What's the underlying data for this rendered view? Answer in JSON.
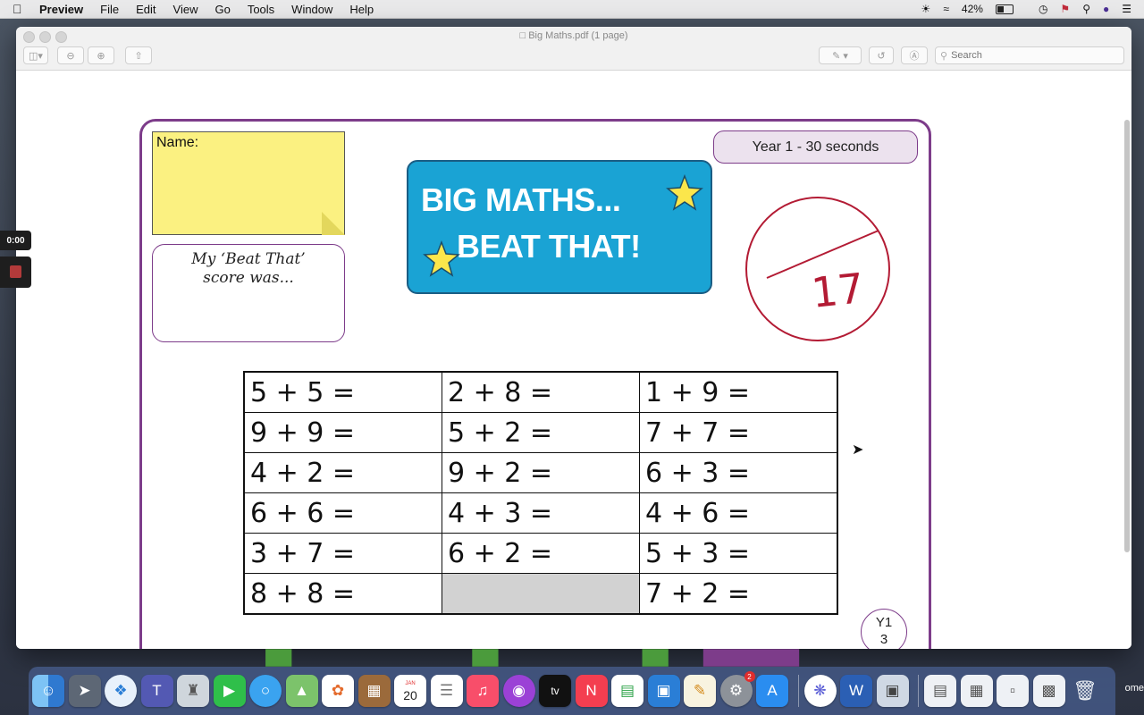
{
  "menubar": {
    "app_name": "Preview",
    "items": [
      "File",
      "Edit",
      "View",
      "Go",
      "Tools",
      "Window",
      "Help"
    ],
    "battery": "42%"
  },
  "window": {
    "title": "Big Maths.pdf (1 page)",
    "search_placeholder": "Search"
  },
  "recording": {
    "time": "0:00"
  },
  "sheet": {
    "name_label": "Name:",
    "beat_that_line1": "My ‘Beat That’",
    "beat_that_line2": "score was...",
    "banner_line1": "BIG MATHS...",
    "banner_line2": "BEAT THAT!",
    "year_label": "Year 1 - 30 seconds",
    "score": "17",
    "badge_line1": "Y1",
    "badge_line2": "3",
    "questions": [
      [
        "5 + 5 =",
        "2 + 8 =",
        "1 + 9 ="
      ],
      [
        "9 + 9 =",
        "5 + 2 =",
        "7 + 7 ="
      ],
      [
        "4 + 2 =",
        "9 + 2 =",
        "6 + 3 ="
      ],
      [
        "6 + 6 =",
        "4 + 3 =",
        "4 + 6 ="
      ],
      [
        "3 + 7 =",
        "6 + 2 =",
        "5 + 3 ="
      ],
      [
        "8 + 8 =",
        "",
        "7 + 2 ="
      ]
    ]
  },
  "dock": {
    "calendar_month": "JAN",
    "calendar_day": "20",
    "settings_badge": "2",
    "trailing_label": "ome"
  }
}
